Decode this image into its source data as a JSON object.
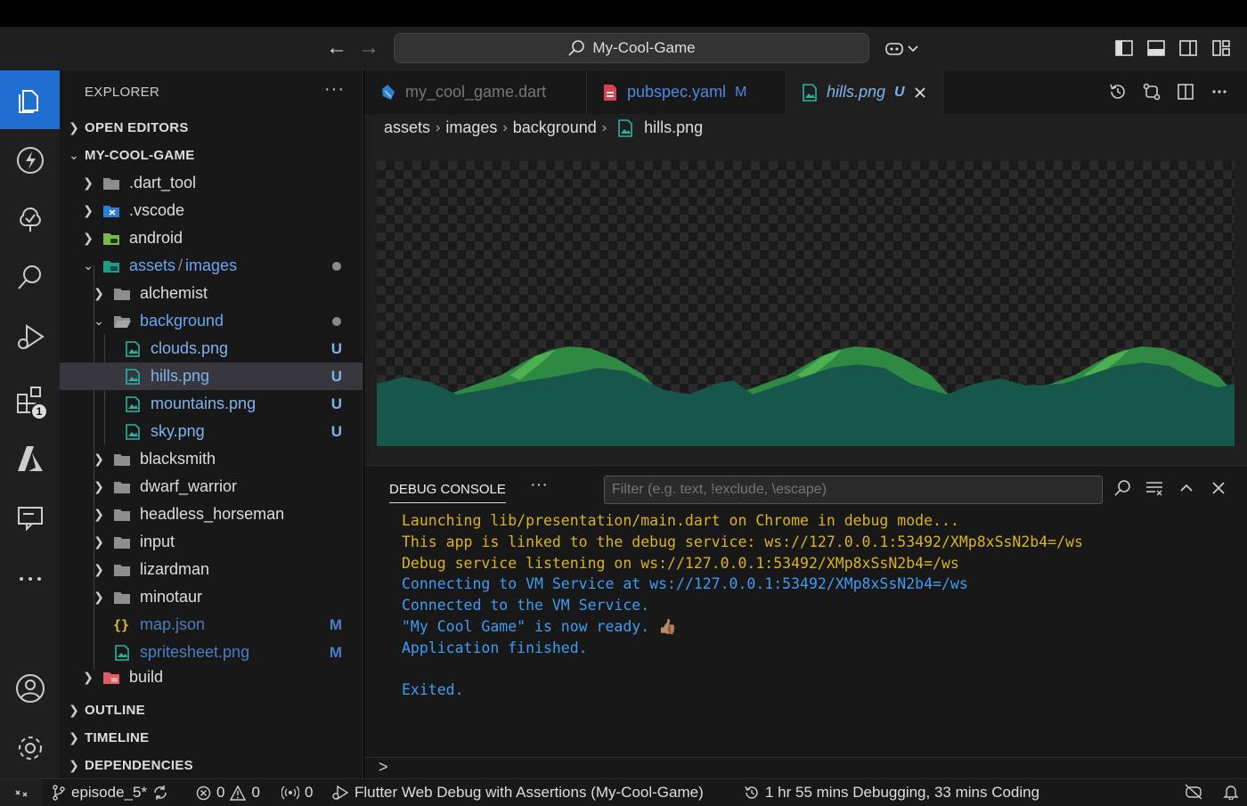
{
  "titlebar": {
    "back_arrow": "←",
    "forward_arrow": "→",
    "search_text": "My-Cool-Game"
  },
  "activitybar": {
    "extensions_badge": "1"
  },
  "sidebar": {
    "title": "EXPLORER",
    "more": "···",
    "sections": {
      "open_editors": "OPEN EDITORS",
      "project": "MY-COOL-GAME",
      "outline": "OUTLINE",
      "timeline": "TIMELINE",
      "dependencies": "DEPENDENCIES"
    },
    "tree": {
      "dart_tool": ".dart_tool",
      "vscode": ".vscode",
      "android": "android",
      "assets_a": "assets",
      "assets_sep": "/",
      "assets_b": "images",
      "alchemist": "alchemist",
      "background": "background",
      "clouds": "clouds.png",
      "clouds_status": "U",
      "hills": "hills.png",
      "hills_status": "U",
      "mountains": "mountains.png",
      "mountains_status": "U",
      "sky": "sky.png",
      "sky_status": "U",
      "blacksmith": "blacksmith",
      "dwarf_warrior": "dwarf_warrior",
      "headless_horseman": "headless_horseman",
      "input": "input",
      "lizardman": "lizardman",
      "minotaur": "minotaur",
      "map_json": "map.json",
      "map_json_status": "M",
      "spritesheet": "spritesheet.png",
      "spritesheet_status": "M",
      "build": "build"
    }
  },
  "tabs": [
    {
      "label": "my_cool_game.dart",
      "status": ""
    },
    {
      "label": "pubspec.yaml",
      "status": "M"
    },
    {
      "label": "hills.png",
      "status": "U"
    }
  ],
  "breadcrumb": [
    "assets",
    "images",
    "background",
    "hills.png"
  ],
  "panel": {
    "tab_label": "DEBUG CONSOLE",
    "more": "···",
    "filter_placeholder": "Filter (e.g. text, !exclude, \\escape)",
    "prompt": ">",
    "lines": [
      {
        "text": "Launching lib/presentation/main.dart on Chrome in debug mode...",
        "color": "#d9b41c"
      },
      {
        "text": "This app is linked to the debug service: ws://127.0.0.1:53492/XMp8xSsN2b4=/ws",
        "color": "#d9b41c"
      },
      {
        "text": "Debug service listening on ws://127.0.0.1:53492/XMp8xSsN2b4=/ws",
        "color": "#d9b41c"
      },
      {
        "text": "Connecting to VM Service at ws://127.0.0.1:53492/XMp8xSsN2b4=/ws",
        "color": "#3f9cf3"
      },
      {
        "text": "Connected to the VM Service.",
        "color": "#3f9cf3"
      },
      {
        "text": "\"My Cool Game\" is now ready. 👍🏽",
        "color": "#3f9cf3"
      },
      {
        "text": "Application finished.",
        "color": "#3f9cf3"
      },
      {
        "text": "",
        "color": "#3f9cf3"
      },
      {
        "text": "Exited.",
        "color": "#3f9cf3"
      }
    ]
  },
  "statusbar": {
    "branch": "episode_5*",
    "errors": "0",
    "warnings": "0",
    "ports": "0",
    "debug_config": "Flutter Web Debug with Assertions (My-Cool-Game)",
    "time_tracking": "1 hr 55 mins Debugging, 33 mins Coding"
  },
  "colors": {
    "accent": "#1f6fd1",
    "hill_dark": "#17564a",
    "hill_light": "#2e8a43",
    "hill_highlight": "#4cb050",
    "untracked": "#7fb3f0",
    "modified": "#4a7ec0"
  }
}
